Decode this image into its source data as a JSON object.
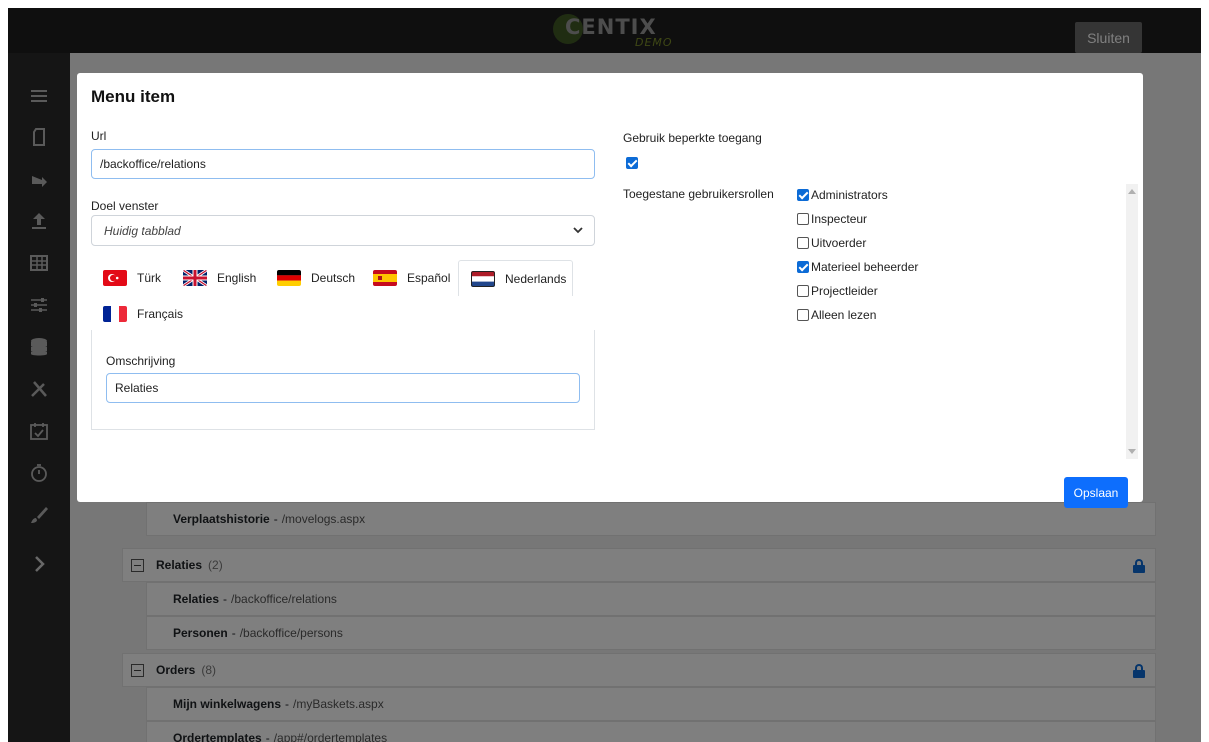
{
  "topbar": {
    "logo_text": "CENTIX",
    "logo_sub": "DEMO",
    "close_label": "Sluiten"
  },
  "sidebar": {
    "items": [
      {
        "icon": "menu-icon"
      },
      {
        "icon": "document-icon"
      },
      {
        "icon": "arrow-right-icon"
      },
      {
        "icon": "upload-icon"
      },
      {
        "icon": "table-icon"
      },
      {
        "icon": "sliders-icon"
      },
      {
        "icon": "database-icon"
      },
      {
        "icon": "tools-icon"
      },
      {
        "icon": "calendar-check-icon"
      },
      {
        "icon": "stopwatch-icon"
      },
      {
        "icon": "brush-icon"
      },
      {
        "icon": "chevron-right-icon"
      }
    ]
  },
  "background_tree": {
    "rows": [
      {
        "kind": "item",
        "title": "Verplaatshistorie",
        "path": "/movelogs.aspx"
      },
      {
        "kind": "group",
        "title": "Relaties",
        "count": "(2)",
        "locked": true
      },
      {
        "kind": "item",
        "title": "Relaties",
        "path": "/backoffice/relations"
      },
      {
        "kind": "item",
        "title": "Personen",
        "path": "/backoffice/persons"
      },
      {
        "kind": "group",
        "title": "Orders",
        "count": "(8)",
        "locked": true
      },
      {
        "kind": "item",
        "title": "Mijn winkelwagens",
        "path": "/myBaskets.aspx"
      },
      {
        "kind": "item",
        "title": "Ordertemplates",
        "path": "/app#/ordertemplates"
      }
    ]
  },
  "modal": {
    "title": "Menu item",
    "url_label": "Url",
    "url_value": "/backoffice/relations",
    "target_label": "Doel venster",
    "target_value": "Huidig tabblad",
    "languages": [
      {
        "label": "Türk",
        "flag": "turkey-flag-icon",
        "active": false
      },
      {
        "label": "English",
        "flag": "uk-flag-icon",
        "active": false
      },
      {
        "label": "Deutsch",
        "flag": "germany-flag-icon",
        "active": false
      },
      {
        "label": "Español",
        "flag": "spain-flag-icon",
        "active": false
      },
      {
        "label": "Nederlands",
        "flag": "netherlands-flag-icon",
        "active": true
      },
      {
        "label": "Français",
        "flag": "france-flag-icon",
        "active": false
      }
    ],
    "description_label": "Omschrijving",
    "description_value": "Relaties",
    "restricted_label": "Gebruik beperkte toegang",
    "restricted_checked": true,
    "roles_label": "Toegestane gebruikersrollen",
    "roles": [
      {
        "label": "Administrators",
        "checked": true
      },
      {
        "label": "Inspecteur",
        "checked": false
      },
      {
        "label": "Uitvoerder",
        "checked": false
      },
      {
        "label": "Materieel beheerder",
        "checked": true
      },
      {
        "label": "Projectleider",
        "checked": false
      },
      {
        "label": "Alleen lezen",
        "checked": false
      }
    ],
    "save_label": "Opslaan"
  },
  "colors": {
    "primary": "#0d6efd",
    "topbar": "#1f1f1f",
    "sidebar": "#2a2a2a"
  }
}
